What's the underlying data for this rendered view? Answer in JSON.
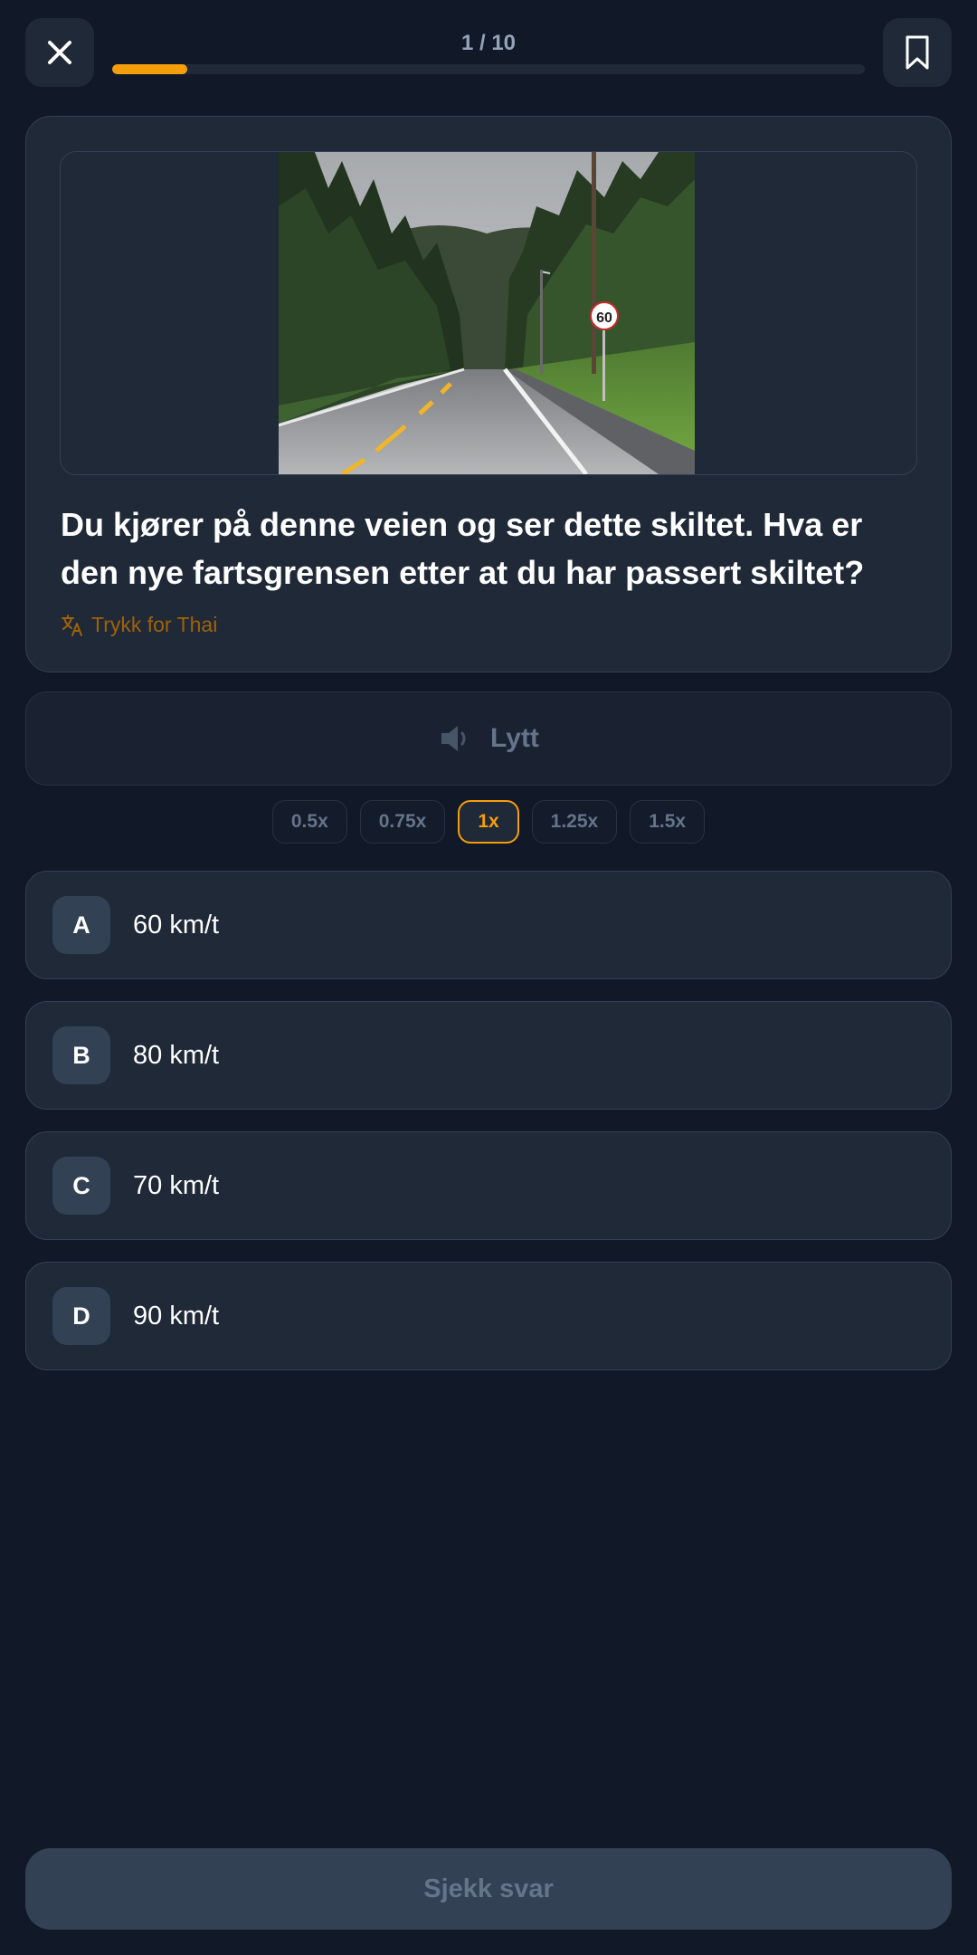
{
  "header": {
    "progress_text": "1 / 10",
    "progress_fraction": 0.1,
    "close_icon": "close-icon",
    "bookmark_icon": "bookmark-icon"
  },
  "question": {
    "image_icon": "road-with-speed-sign-photo",
    "sign_value": "60",
    "text": "Du kjører på denne veien og ser dette skiltet. Hva er den nye fartsgrensen etter at du har passert skiltet?",
    "translate_label": "Trykk for Thai",
    "translate_icon": "translate-icon"
  },
  "listen": {
    "label": "Lytt",
    "icon": "speaker-icon"
  },
  "speeds": [
    "0.5x",
    "0.75x",
    "1x",
    "1.25x",
    "1.5x"
  ],
  "selected_speed": "1x",
  "options": [
    {
      "letter": "A",
      "text": "60 km/t"
    },
    {
      "letter": "B",
      "text": "80 km/t"
    },
    {
      "letter": "C",
      "text": "70 km/t"
    },
    {
      "letter": "D",
      "text": "90 km/t"
    }
  ],
  "check_button": "Sjekk svar",
  "colors": {
    "background": "#111827",
    "card": "#1f2937",
    "accent": "#f59e0b",
    "muted": "#64748b"
  }
}
